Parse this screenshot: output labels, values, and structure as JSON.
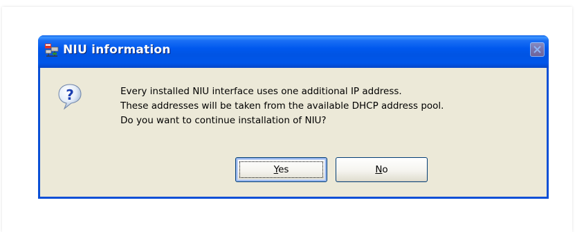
{
  "dialog": {
    "title": "NIU information",
    "app_icon": "niu-app-icon",
    "close_icon": "close-icon",
    "message_icon": "question-icon",
    "message_lines": [
      "Every installed NIU interface uses one additional IP address.",
      "These addresses will be taken from the available DHCP address pool.",
      "Do you want to continue installation of NIU?"
    ],
    "buttons": {
      "yes_mnemonic": "Y",
      "yes_rest": "es",
      "no_mnemonic": "N",
      "no_rest": "o"
    }
  },
  "colors": {
    "titlebar": "#0054e3",
    "client": "#ece9d8",
    "title_text": "#ffffff"
  }
}
